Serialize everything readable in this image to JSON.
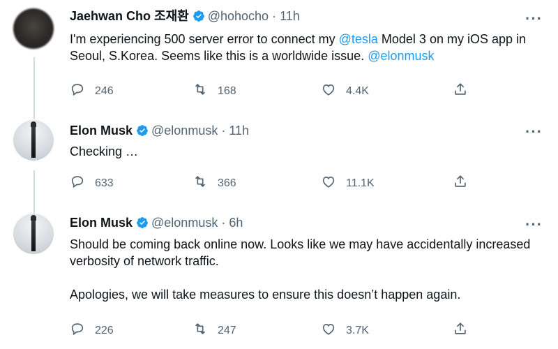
{
  "tweets": [
    {
      "name": "Jaehwan Cho 조재환",
      "handle": "@hohocho",
      "dot": "·",
      "time": "11h",
      "body": {
        "text1": "I'm experiencing 500 server error to connect my ",
        "mention1": "@tesla",
        "text2": " Model 3 on my iOS app in Seoul, S.Korea. Seems like this is a worldwide issue. ",
        "mention2": "@elonmusk"
      },
      "replies": "246",
      "retweets": "168",
      "likes": "4.4K"
    },
    {
      "name": "Elon Musk",
      "handle": "@elonmusk",
      "dot": "·",
      "time": "11h",
      "body": {
        "text1": "Checking …"
      },
      "replies": "633",
      "retweets": "366",
      "likes": "11.1K"
    },
    {
      "name": "Elon Musk",
      "handle": "@elonmusk",
      "dot": "·",
      "time": "6h",
      "body": {
        "para1": "Should be coming back online now. Looks like we may have accidentally increased verbosity of network traffic.",
        "para2": "Apologies, we will take measures to ensure this doesn’t happen again."
      },
      "replies": "226",
      "retweets": "247",
      "likes": "3.7K"
    }
  ],
  "more_label": "···",
  "icons": {
    "reply": "reply-icon",
    "retweet": "retweet-icon",
    "like": "like-icon",
    "share": "share-icon",
    "verified": "verified-badge-icon"
  },
  "colors": {
    "link": "#1d9bf0",
    "muted": "#536471",
    "verified": "#1d9bf0"
  }
}
